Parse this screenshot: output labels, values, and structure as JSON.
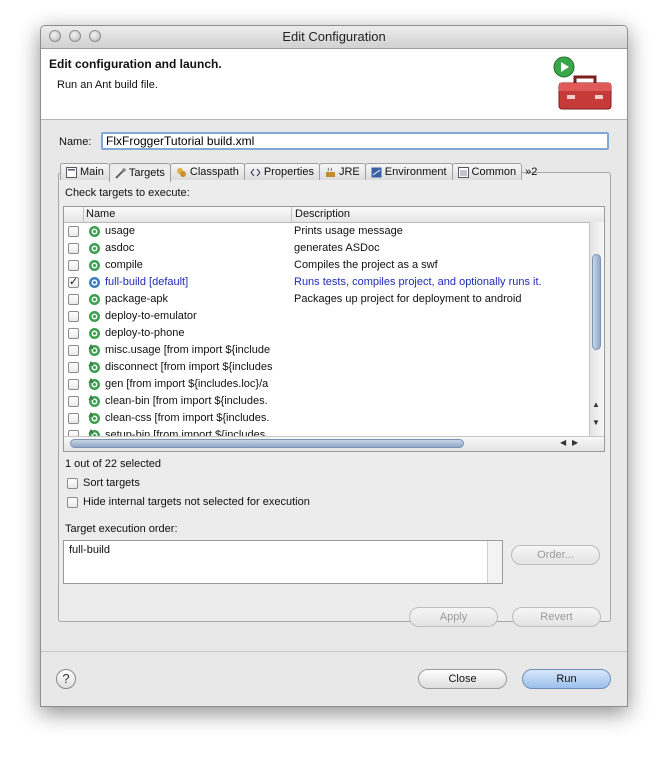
{
  "window": {
    "title": "Edit Configuration"
  },
  "header": {
    "title": "Edit configuration and launch.",
    "subtitle": "Run an Ant build file.",
    "icon": "toolbox-run-icon"
  },
  "name_field": {
    "label": "Name:",
    "value": "FlxFroggerTutorial build.xml"
  },
  "tabs": [
    {
      "label": "Main",
      "icon": "main-icon",
      "active": false
    },
    {
      "label": "Targets",
      "icon": "targets-icon",
      "active": true
    },
    {
      "label": "Classpath",
      "icon": "classpath-icon",
      "active": false
    },
    {
      "label": "Properties",
      "icon": "properties-icon",
      "active": false
    },
    {
      "label": "JRE",
      "icon": "jre-icon",
      "active": false
    },
    {
      "label": "Environment",
      "icon": "environment-icon",
      "active": false
    },
    {
      "label": "Common",
      "icon": "common-icon",
      "active": false
    }
  ],
  "tabs_overflow": "»2",
  "targets": {
    "heading": "Check targets to execute:",
    "columns": [
      "Name",
      "Description"
    ],
    "rows": [
      {
        "name": "usage",
        "desc": "Prints usage message",
        "checked": false,
        "imported": false
      },
      {
        "name": "asdoc",
        "desc": "generates ASDoc",
        "checked": false,
        "imported": false
      },
      {
        "name": "compile",
        "desc": "Compiles the project as a swf",
        "checked": false,
        "imported": false
      },
      {
        "name": "full-build [default]",
        "desc": "Runs tests, compiles project, and optionally runs it.",
        "checked": true,
        "imported": false,
        "default": true
      },
      {
        "name": "package-apk",
        "desc": "Packages up project for deployment to android",
        "checked": false,
        "imported": false
      },
      {
        "name": "deploy-to-emulator",
        "desc": "",
        "checked": false,
        "imported": false
      },
      {
        "name": "deploy-to-phone",
        "desc": "",
        "checked": false,
        "imported": false
      },
      {
        "name": "misc.usage [from import ${include",
        "desc": "",
        "checked": false,
        "imported": true
      },
      {
        "name": "disconnect [from import ${includes",
        "desc": "",
        "checked": false,
        "imported": true
      },
      {
        "name": "gen [from import ${includes.loc}/a",
        "desc": "",
        "checked": false,
        "imported": true
      },
      {
        "name": "clean-bin [from import ${includes.",
        "desc": "",
        "checked": false,
        "imported": true
      },
      {
        "name": "clean-css [from import ${includes.",
        "desc": "",
        "checked": false,
        "imported": true
      },
      {
        "name": "setup-bin [from import ${includes",
        "desc": "",
        "checked": false,
        "imported": true
      }
    ],
    "selected_count": "1 out of 22 selected"
  },
  "options": {
    "sort": "Sort targets",
    "hide_internal": "Hide internal targets not selected for execution"
  },
  "order": {
    "label": "Target execution order:",
    "value": "full-build",
    "button": "Order..."
  },
  "buttons": {
    "apply": "Apply",
    "revert": "Revert",
    "close": "Close",
    "run": "Run",
    "help": "?"
  },
  "colors": {
    "target_green": "#2f9b45",
    "selected_text": "#1f2bb8",
    "default_button": "#9cc0ec"
  }
}
